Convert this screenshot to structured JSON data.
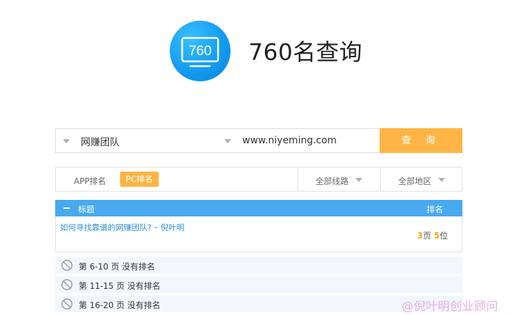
{
  "header": {
    "logo_text": "760",
    "title": "760名查询"
  },
  "search": {
    "keyword_value": "网赚团队",
    "url_value": "www.niyeming.com",
    "query_label": "查 询"
  },
  "filter": {
    "app_label": "APP排名",
    "pc_label": "PC排名",
    "line_label": "全部线路",
    "region_label": "全部地区"
  },
  "table": {
    "head_title": "标题",
    "head_rank": "排名",
    "result": {
      "title": "如何寻找靠谱的网赚团队? – 倪叶明",
      "page": "3",
      "page_unit": "页",
      "position": "5",
      "position_unit": "位"
    },
    "no_rank_rows": [
      "第 6-10 页 没有排名",
      "第 11-15 页 没有排名",
      "第 16-20 页 没有排名"
    ]
  },
  "watermark": "@倪叶明创业顾问",
  "colors": {
    "accent_orange": "#ffb545",
    "table_blue": "#48a9ee",
    "link_blue": "#2b8fd8",
    "logo_blue": "#139cf0"
  }
}
